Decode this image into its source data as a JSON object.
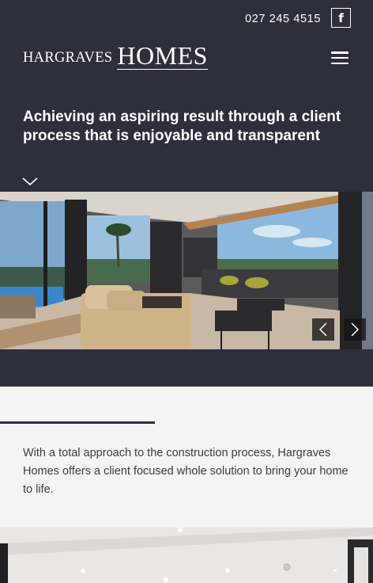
{
  "header": {
    "phone": "027 245 4515",
    "facebook_glyph": "f",
    "logo_small": "HARGRAVES",
    "logo_big": "HOMES",
    "tagline": "Achieving an aspiring result through a client process that is enjoyable and transparent"
  },
  "icons": {
    "facebook": "facebook-icon",
    "menu": "hamburger-menu-icon",
    "scroll": "chevron-down-icon",
    "prev": "chevron-left-icon",
    "next": "chevron-right-icon"
  },
  "intro": {
    "text": "With a total approach to the construction process, Hargraves Homes offers a client focused whole solution to bring your home to life."
  },
  "colors": {
    "header_bg": "#2f2e3b",
    "page_bg": "#f4f4f4",
    "text": "#3d3d3d"
  }
}
